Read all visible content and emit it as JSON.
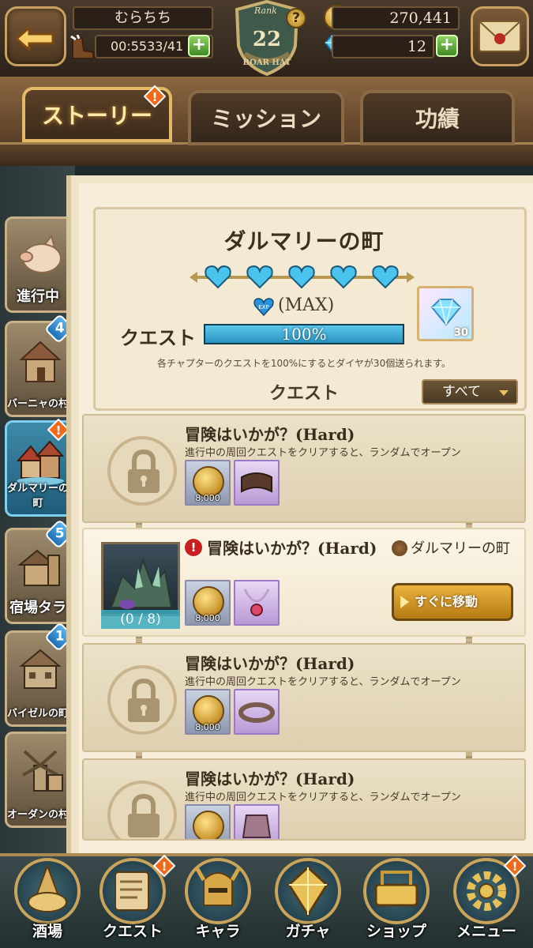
{
  "player": {
    "name": "むらちち",
    "stamina_timer": "00:55",
    "stamina": "33/41"
  },
  "rank": {
    "label": "Rank",
    "value": "22",
    "title": "BOAR HAT"
  },
  "currency": {
    "gold": "270,441",
    "gems": "12"
  },
  "tabs": [
    {
      "label": "ストーリー",
      "active": true,
      "alert": true
    },
    {
      "label": "ミッション",
      "active": false
    },
    {
      "label": "功績",
      "active": false
    }
  ],
  "sidebar": [
    {
      "label": "進行中",
      "badge": ""
    },
    {
      "label": "バーニャの村",
      "badge": "4"
    },
    {
      "label": "ダルマリーの町",
      "badge": "!",
      "active": true
    },
    {
      "label": "宿場タラ",
      "badge": "5"
    },
    {
      "label": "バイゼルの町",
      "badge": "1"
    },
    {
      "label": "オーダンの村",
      "badge": ""
    }
  ],
  "chapter": {
    "title": "ダルマリーの町",
    "hearts": 5,
    "exp_badge": "EXP",
    "exp_status": "(MAX)",
    "quest_label": "クエスト",
    "progress_text": "100%",
    "progress_fraction": 1.0,
    "reward_count": "30",
    "note": "各チャプターのクエストを100%にするとダイヤが30個送られます。"
  },
  "quest_list": {
    "title": "クエスト",
    "filter": "すべて",
    "items": [
      {
        "name": "冒険はいかが？(Hard)",
        "desc": "進行中の周回クエストをクリアすると、ランダムでオープン",
        "coin": "8,000",
        "locked": true
      },
      {
        "name": "冒険はいかが？(Hard)",
        "town": "ダルマリーの町",
        "coin": "8,000",
        "progress": "(0 / 8)",
        "button": "すぐに移動",
        "locked": false
      },
      {
        "name": "冒険はいかが？(Hard)",
        "desc": "進行中の周回クエストをクリアすると、ランダムでオープン",
        "coin": "8,000",
        "locked": true
      },
      {
        "name": "冒険はいかが？(Hard)",
        "desc": "進行中の周回クエストをクリアすると、ランダムでオープン",
        "coin": "",
        "locked": true
      }
    ]
  },
  "bottom_nav": [
    {
      "label": "酒場",
      "alert": false
    },
    {
      "label": "クエスト",
      "alert": true
    },
    {
      "label": "キャラ",
      "alert": false
    },
    {
      "label": "ガチャ",
      "alert": false
    },
    {
      "label": "ショップ",
      "alert": false
    },
    {
      "label": "メニュー",
      "alert": true
    }
  ],
  "colors": {
    "accent_gold": "#e3b968",
    "progress_blue": "#2b92c0",
    "alert_orange": "#f06a1a",
    "badge_blue": "#1f6fb4"
  }
}
